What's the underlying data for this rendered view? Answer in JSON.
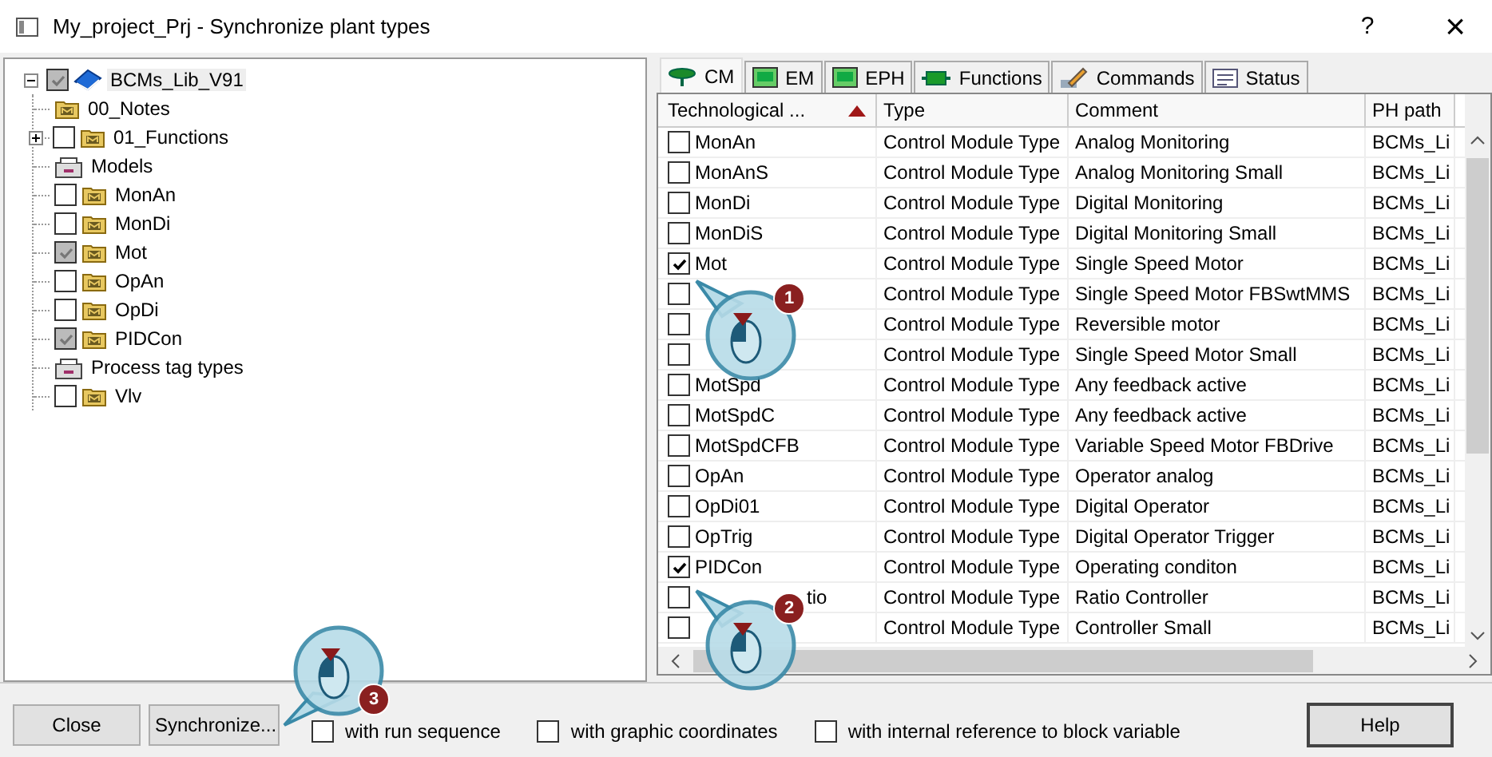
{
  "window": {
    "title": "My_project_Prj - Synchronize plant types",
    "help": "?",
    "close": "×"
  },
  "tree": {
    "label": "BCMs_Lib_V91",
    "kind": "library",
    "checked": true,
    "expanded": true,
    "children": [
      {
        "label": "00_Notes",
        "kind": "note"
      },
      {
        "label": "01_Functions",
        "kind": "folder",
        "checked": false,
        "expanded": false
      },
      {
        "label": "Models",
        "kind": "group"
      },
      {
        "label": "MonAn",
        "kind": "folder",
        "checked": false
      },
      {
        "label": "MonDi",
        "kind": "folder",
        "checked": false
      },
      {
        "label": "Mot",
        "kind": "folder",
        "checked": true
      },
      {
        "label": "OpAn",
        "kind": "folder",
        "checked": false
      },
      {
        "label": "OpDi",
        "kind": "folder",
        "checked": false
      },
      {
        "label": "PIDCon",
        "kind": "folder",
        "checked": true
      },
      {
        "label": "Process tag types",
        "kind": "group"
      },
      {
        "label": "Vlv",
        "kind": "folder",
        "checked": false
      }
    ]
  },
  "tabs": [
    {
      "label": "CM",
      "selected": true
    },
    {
      "label": "EM",
      "selected": false
    },
    {
      "label": "EPH",
      "selected": false
    },
    {
      "label": "Functions",
      "selected": false
    },
    {
      "label": "Commands",
      "selected": false
    },
    {
      "label": "Status",
      "selected": false
    }
  ],
  "table": {
    "columns": [
      "Technological ...",
      "Type",
      "Comment",
      "PH path"
    ],
    "rows": [
      {
        "checked": false,
        "name": "MonAn",
        "type": "Control Module Type",
        "comment": "Analog Monitoring",
        "path": "BCMs_Li"
      },
      {
        "checked": false,
        "name": "MonAnS",
        "type": "Control Module Type",
        "comment": "Analog Monitoring Small",
        "path": "BCMs_Li"
      },
      {
        "checked": false,
        "name": "MonDi",
        "type": "Control Module Type",
        "comment": "Digital Monitoring",
        "path": "BCMs_Li"
      },
      {
        "checked": false,
        "name": "MonDiS",
        "type": "Control Module Type",
        "comment": "Digital Monitoring Small",
        "path": "BCMs_Li"
      },
      {
        "checked": true,
        "name": "Mot",
        "type": "Control Module Type",
        "comment": "Single Speed Motor",
        "path": "BCMs_Li"
      },
      {
        "checked": false,
        "type": "Control Module Type",
        "comment": "Single Speed Motor FBSwtMMS",
        "path": "BCMs_Li"
      },
      {
        "checked": false,
        "type": "Control Module Type",
        "comment": "Reversible motor",
        "path": "BCMs_Li"
      },
      {
        "checked": false,
        "type": "Control Module Type",
        "comment": "Single Speed Motor Small",
        "path": "BCMs_Li"
      },
      {
        "checked": false,
        "name": "MotSpd",
        "type": "Control Module Type",
        "comment": "Any feedback active",
        "path": "BCMs_Li"
      },
      {
        "checked": false,
        "name": "MotSpdC",
        "type": "Control Module Type",
        "comment": "Any feedback active",
        "path": "BCMs_Li"
      },
      {
        "checked": false,
        "name": "MotSpdCFB",
        "type": "Control Module Type",
        "comment": "Variable Speed Motor FBDrive",
        "path": "BCMs_Li"
      },
      {
        "checked": false,
        "name": "OpAn",
        "type": "Control Module Type",
        "comment": "Operator analog",
        "path": "BCMs_Li"
      },
      {
        "checked": false,
        "name": "OpDi01",
        "type": "Control Module Type",
        "comment": "Digital Operator",
        "path": "BCMs_Li"
      },
      {
        "checked": false,
        "name": "OpTrig",
        "type": "Control Module Type",
        "comment": "Digital Operator Trigger",
        "path": "BCMs_Li"
      },
      {
        "checked": true,
        "name": "PIDCon",
        "type": "Control Module Type",
        "comment": "Operating conditon",
        "path": "BCMs_Li"
      },
      {
        "checked": false,
        "name": "tio",
        "covered": true,
        "type": "Control Module Type",
        "comment": "Ratio Controller",
        "path": "BCMs_Li"
      },
      {
        "checked": false,
        "type": "Control Module Type",
        "comment": "Controller Small",
        "path": "BCMs_Li"
      }
    ]
  },
  "buttons": [
    "Close",
    "Synchronize...",
    "Help"
  ],
  "options": [
    {
      "label": "with run sequence",
      "checked": false
    },
    {
      "label": "with graphic coordinates",
      "checked": false
    },
    {
      "label": "with internal reference to block variable",
      "checked": false
    }
  ],
  "callouts": [
    {
      "number": "1"
    },
    {
      "number": "2"
    },
    {
      "number": "3"
    }
  ]
}
